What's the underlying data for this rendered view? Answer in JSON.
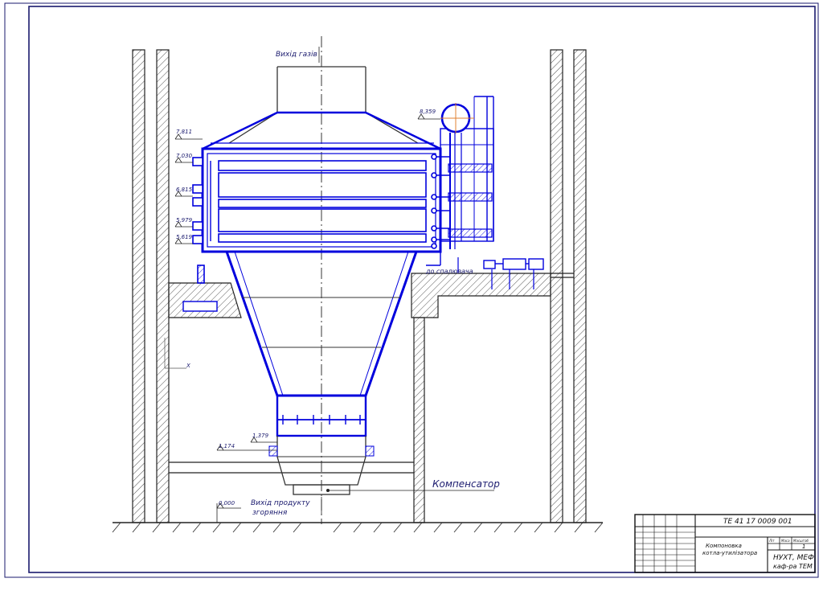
{
  "labels": {
    "exhaust_gas": "Вихід газів",
    "product_outlet_line1": "Вихід продукту",
    "product_outlet_line2": "згоряння",
    "compensator": "Компенсатор",
    "to_feeder": "до спалювача",
    "axis_x": "X"
  },
  "levels": [
    "7,811",
    "7,030",
    "6,815",
    "5,979",
    "5,619",
    "8,359",
    "1,379",
    "1,174",
    "0,000"
  ],
  "title_block": {
    "designation": "ТЕ 41 17 0009 001",
    "name_line1": "Компоновка",
    "name_line2": "котла-утилізатора",
    "sheet": "1",
    "org_line1": "НУХТ, МЕФ",
    "org_line2": "каф-ра ТЕМ",
    "col_lit": "Літ",
    "col_mass": "Маса",
    "col_scale": "Масштаб",
    "col_sheet": "Аркуш",
    "col_sheets": "Аркушів"
  },
  "colors": {
    "structure": "#0000dd",
    "frame": "#1a1a6e",
    "hatch": "#444444"
  }
}
